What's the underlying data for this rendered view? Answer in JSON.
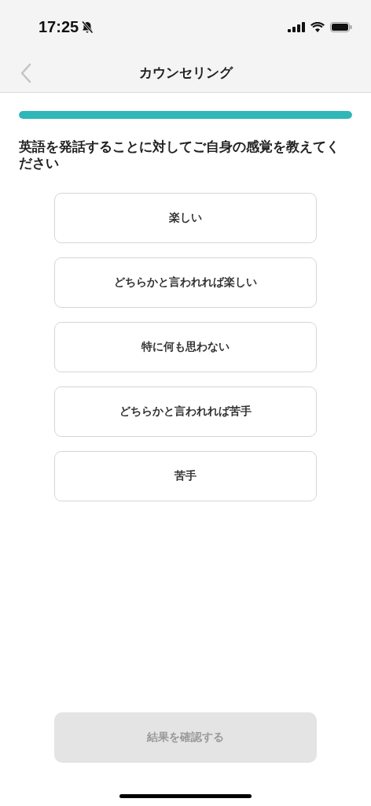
{
  "status_bar": {
    "time": "17:25",
    "silent": true
  },
  "nav": {
    "title": "カウンセリング"
  },
  "progress": {
    "level": 1
  },
  "question": "英語を発話することに対してご自身の感覚を教えてください",
  "options": [
    {
      "label": "楽しい",
      "selected": false
    },
    {
      "label": "どちらかと言われれば楽しい",
      "selected": false
    },
    {
      "label": "特に何も思わない",
      "selected": false
    },
    {
      "label": "どちらかと言われれば苦手",
      "selected": false
    },
    {
      "label": "苦手",
      "selected": false
    }
  ],
  "submit": {
    "label": "結果を確認する",
    "disabled": true
  }
}
